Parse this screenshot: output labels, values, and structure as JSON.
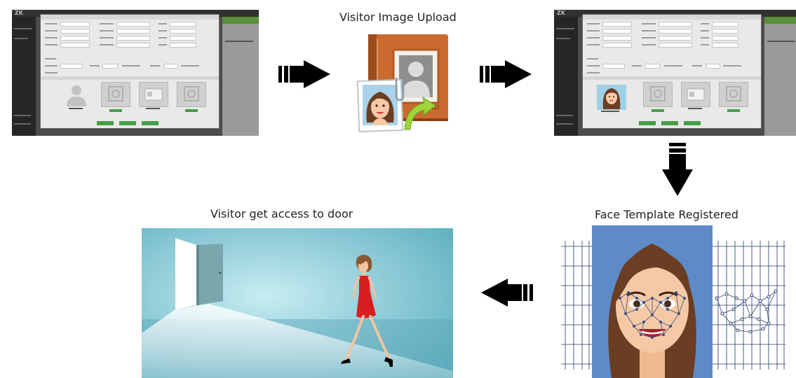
{
  "captions": {
    "upload": "Visitor Image Upload",
    "registered": "Face Template Registered",
    "access": "Visitor get access to door"
  },
  "screenshots": {
    "logo": "ZK"
  },
  "colors": {
    "accent_green": "#43a047",
    "door_bg": "#7fc6d1",
    "dress_red": "#d81e1e",
    "album_orange": "#c86a2d",
    "upload_arrow": "#9fd43a",
    "face_bg": "#4f7fc0"
  },
  "icons": [
    "arrow-right-icon",
    "arrow-down-icon",
    "arrow-left-icon",
    "photo-album-icon",
    "upload-arrow-icon"
  ]
}
